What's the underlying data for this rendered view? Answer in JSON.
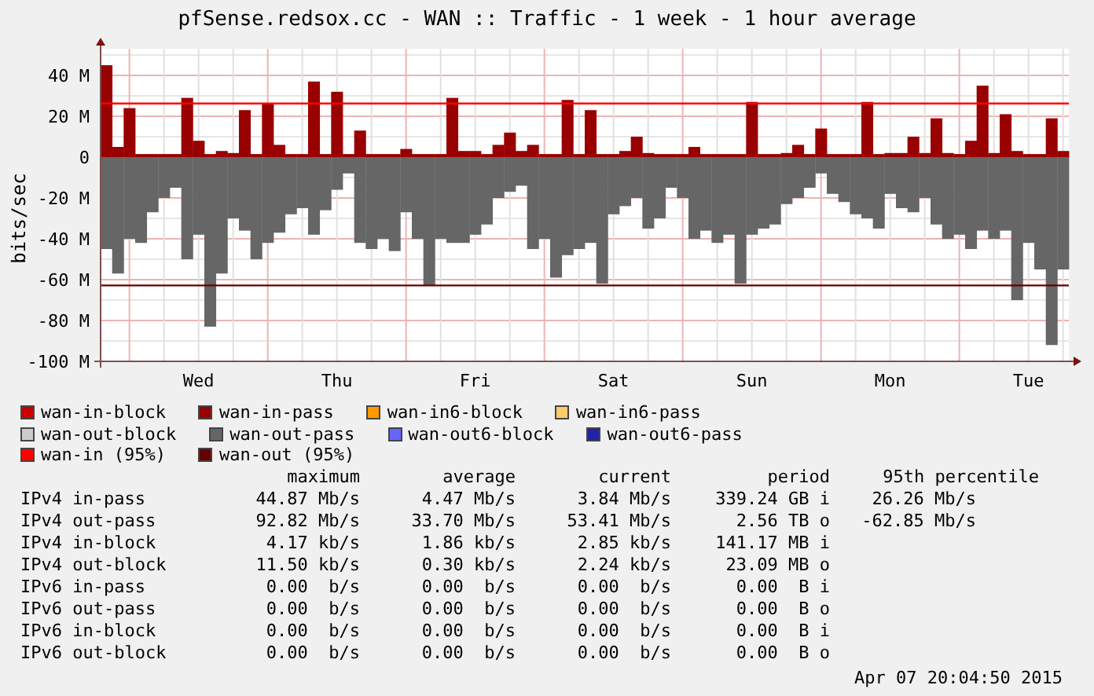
{
  "title": "pfSense.redsox.cc - WAN :: Traffic - 1 week - 1 hour average",
  "chart_data": {
    "type": "bar",
    "ylabel": "bits/sec",
    "stacked": true,
    "grid": true,
    "ylim": [
      -100,
      53
    ],
    "categories": [
      null,
      null,
      null,
      null,
      null,
      null,
      null,
      null,
      "Wed",
      null,
      null,
      null,
      null,
      null,
      null,
      null,
      null,
      null,
      null,
      null,
      "Thu",
      null,
      null,
      null,
      null,
      null,
      null,
      null,
      null,
      null,
      null,
      null,
      "Fri",
      null,
      null,
      null,
      null,
      null,
      null,
      null,
      null,
      null,
      null,
      null,
      "Sat",
      null,
      null,
      null,
      null,
      null,
      null,
      null,
      null,
      null,
      null,
      null,
      "Sun",
      null,
      null,
      null,
      null,
      null,
      null,
      null,
      null,
      null,
      null,
      null,
      "Mon",
      null,
      null,
      null,
      null,
      null,
      null,
      null,
      null,
      null,
      null,
      null,
      "Tue",
      null,
      null,
      null
    ],
    "yticks": [
      {
        "value": 40,
        "label": "40 M"
      },
      {
        "value": 20,
        "label": "20 M"
      },
      {
        "value": 0,
        "label": "0"
      },
      {
        "value": -20,
        "label": "-20 M"
      },
      {
        "value": -40,
        "label": "-40 M"
      },
      {
        "value": -60,
        "label": "-60 M"
      },
      {
        "value": -80,
        "label": "-80 M"
      },
      {
        "value": -100,
        "label": "-100 M"
      }
    ],
    "series": [
      {
        "name": "wan-in-pass",
        "color": "#990000",
        "values": [
          45,
          5,
          24,
          1.5,
          1.5,
          1.5,
          1.5,
          29,
          8,
          1.5,
          3,
          2,
          23,
          1.5,
          26,
          6,
          1.5,
          1.5,
          37,
          1.5,
          32,
          1.5,
          13,
          1.5,
          1.5,
          1.5,
          4,
          1.5,
          1.5,
          1.5,
          29,
          3,
          3,
          1.5,
          6,
          12,
          3,
          6,
          1.5,
          1.5,
          28,
          1.5,
          23,
          1.5,
          1.5,
          3,
          10,
          2,
          1.5,
          1.5,
          1.5,
          5,
          1.5,
          1.5,
          1.5,
          1.5,
          27,
          1.5,
          1.5,
          2,
          6,
          1.5,
          14,
          1.5,
          1.5,
          1.5,
          27,
          1.5,
          2,
          2,
          10,
          2,
          19,
          2,
          1.5,
          8,
          35,
          2,
          21,
          3,
          1.5,
          1.5,
          19,
          3
        ]
      },
      {
        "name": "wan-out-pass",
        "color": "#666666",
        "values": [
          -45,
          -57,
          -40,
          -42,
          -27,
          -20,
          -15,
          -50,
          -38,
          -83,
          -57,
          -30,
          -36,
          -50,
          -42,
          -37,
          -28,
          -25,
          -38,
          -26,
          -16,
          -8,
          -42,
          -45,
          -40,
          -46,
          -27,
          -40,
          -63,
          -40,
          -42,
          -42,
          -38,
          -33,
          -20,
          -17,
          -14,
          -45,
          -40,
          -59,
          -48,
          -45,
          -42,
          -62,
          -28,
          -24,
          -20,
          -35,
          -30,
          -15,
          -20,
          -40,
          -36,
          -42,
          -38,
          -62,
          -38,
          -35,
          -33,
          -23,
          -20,
          -15,
          -8,
          -18,
          -22,
          -28,
          -30,
          -35,
          -18,
          -25,
          -27,
          -20,
          -33,
          -40,
          -38,
          -45,
          -36,
          -40,
          -36,
          -70,
          -42,
          -55,
          -92,
          -55
        ]
      }
    ],
    "ref_lines": [
      {
        "axis": "y",
        "value": 26.26,
        "color": "#ff0000"
      },
      {
        "axis": "y",
        "value": -62.85,
        "color": "#660000"
      }
    ]
  },
  "legend": [
    [
      {
        "kind": "entry",
        "label": "wan-in-block",
        "color": "#cc0000"
      },
      {
        "kind": "series"
      },
      {
        "kind": "entry",
        "label": "wan-in6-block",
        "color": "#ff9900"
      },
      {
        "kind": "entry",
        "label": "wan-in6-pass",
        "color": "#ffcc66"
      }
    ],
    [
      {
        "kind": "entry",
        "label": "wan-out-block",
        "color": "#cccccc"
      },
      {
        "kind": "series"
      },
      {
        "kind": "entry",
        "label": "wan-out6-block",
        "color": "#6666ff"
      },
      {
        "kind": "entry",
        "label": "wan-out6-pass",
        "color": "#2222aa"
      }
    ],
    [
      {
        "kind": "entry",
        "label": "wan-in (95%)",
        "color": "#ff0000"
      },
      {
        "kind": "entry",
        "label": "wan-out (95%)",
        "color": "#660000"
      }
    ]
  ],
  "stats": {
    "columns": [
      "",
      "maximum",
      "average",
      "current",
      "period",
      "95th percentile"
    ],
    "rows": [
      [
        "IPv4 in-pass",
        "44.87 Mb/s",
        "4.47 Mb/s",
        "3.84 Mb/s",
        "339.24 GB i",
        "26.26 Mb/s"
      ],
      [
        "IPv4 out-pass",
        "92.82 Mb/s",
        "33.70 Mb/s",
        "53.41 Mb/s",
        "2.56 TB o",
        "-62.85 Mb/s"
      ],
      [
        "IPv4 in-block",
        "4.17 kb/s",
        "1.86 kb/s",
        "2.85 kb/s",
        "141.17 MB i"
      ],
      [
        "IPv4 out-block",
        "11.50 kb/s",
        "0.30 kb/s",
        "2.24 kb/s",
        "23.09 MB o"
      ],
      [
        "IPv6 in-pass",
        "0.00  b/s",
        "0.00  b/s",
        "0.00  b/s",
        "0.00  B i"
      ],
      [
        "IPv6 out-pass",
        "0.00  b/s",
        "0.00  b/s",
        "0.00  b/s",
        "0.00  B o"
      ],
      [
        "IPv6 in-block",
        "0.00  b/s",
        "0.00  b/s",
        "0.00  b/s",
        "0.00  B i"
      ],
      [
        "IPv6 out-block",
        "0.00  b/s",
        "0.00  b/s",
        "0.00  b/s",
        "0.00  B o"
      ]
    ]
  },
  "timestamp": "Apr 07 20:04:50 2015"
}
